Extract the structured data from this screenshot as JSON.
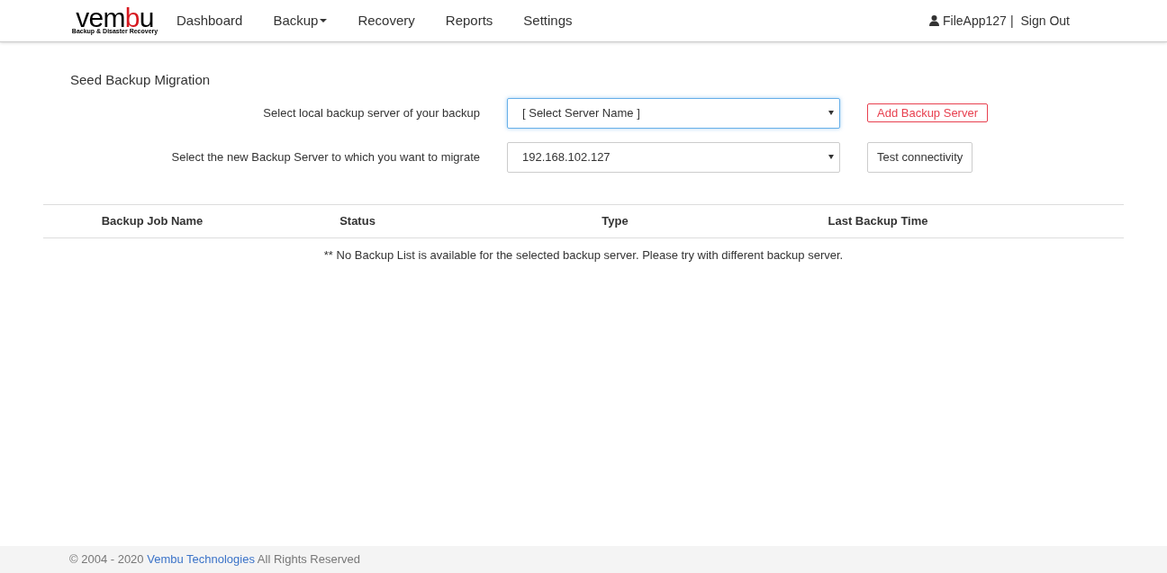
{
  "logo": {
    "parts": [
      {
        "text": "vem",
        "accent": false
      },
      {
        "text": "b",
        "accent": true
      },
      {
        "text": "u",
        "accent": false
      }
    ],
    "tagline": "Backup & Disaster Recovery"
  },
  "nav": [
    {
      "label": "Dashboard",
      "dropdown": false
    },
    {
      "label": "Backup",
      "dropdown": true
    },
    {
      "label": "Recovery",
      "dropdown": false
    },
    {
      "label": "Reports",
      "dropdown": false
    },
    {
      "label": "Settings",
      "dropdown": false
    }
  ],
  "user": {
    "name": "FileApp127",
    "separator": "|",
    "sign_out": "Sign Out"
  },
  "page_title": "Seed Backup Migration",
  "form_rows": [
    {
      "label": "Select local backup server of your backup",
      "value": "[ Select Server Name ]",
      "focused": true,
      "button": "Add Backup Server",
      "kind": "danger"
    },
    {
      "label": "Select the new Backup Server to which you want to migrate",
      "value": "192.168.102.127",
      "focused": false,
      "button": "Test connectivity",
      "kind": "default"
    }
  ],
  "table": {
    "columns": [
      "Backup Job Name",
      "Status",
      "Type",
      "Last Backup Time"
    ],
    "empty_message": "** No Backup List is available for the selected backup server. Please try with different backup server."
  },
  "footer": {
    "prefix": "© 2004 - 2020",
    "link": "Vembu Technologies",
    "suffix": "All Rights Reserved"
  }
}
